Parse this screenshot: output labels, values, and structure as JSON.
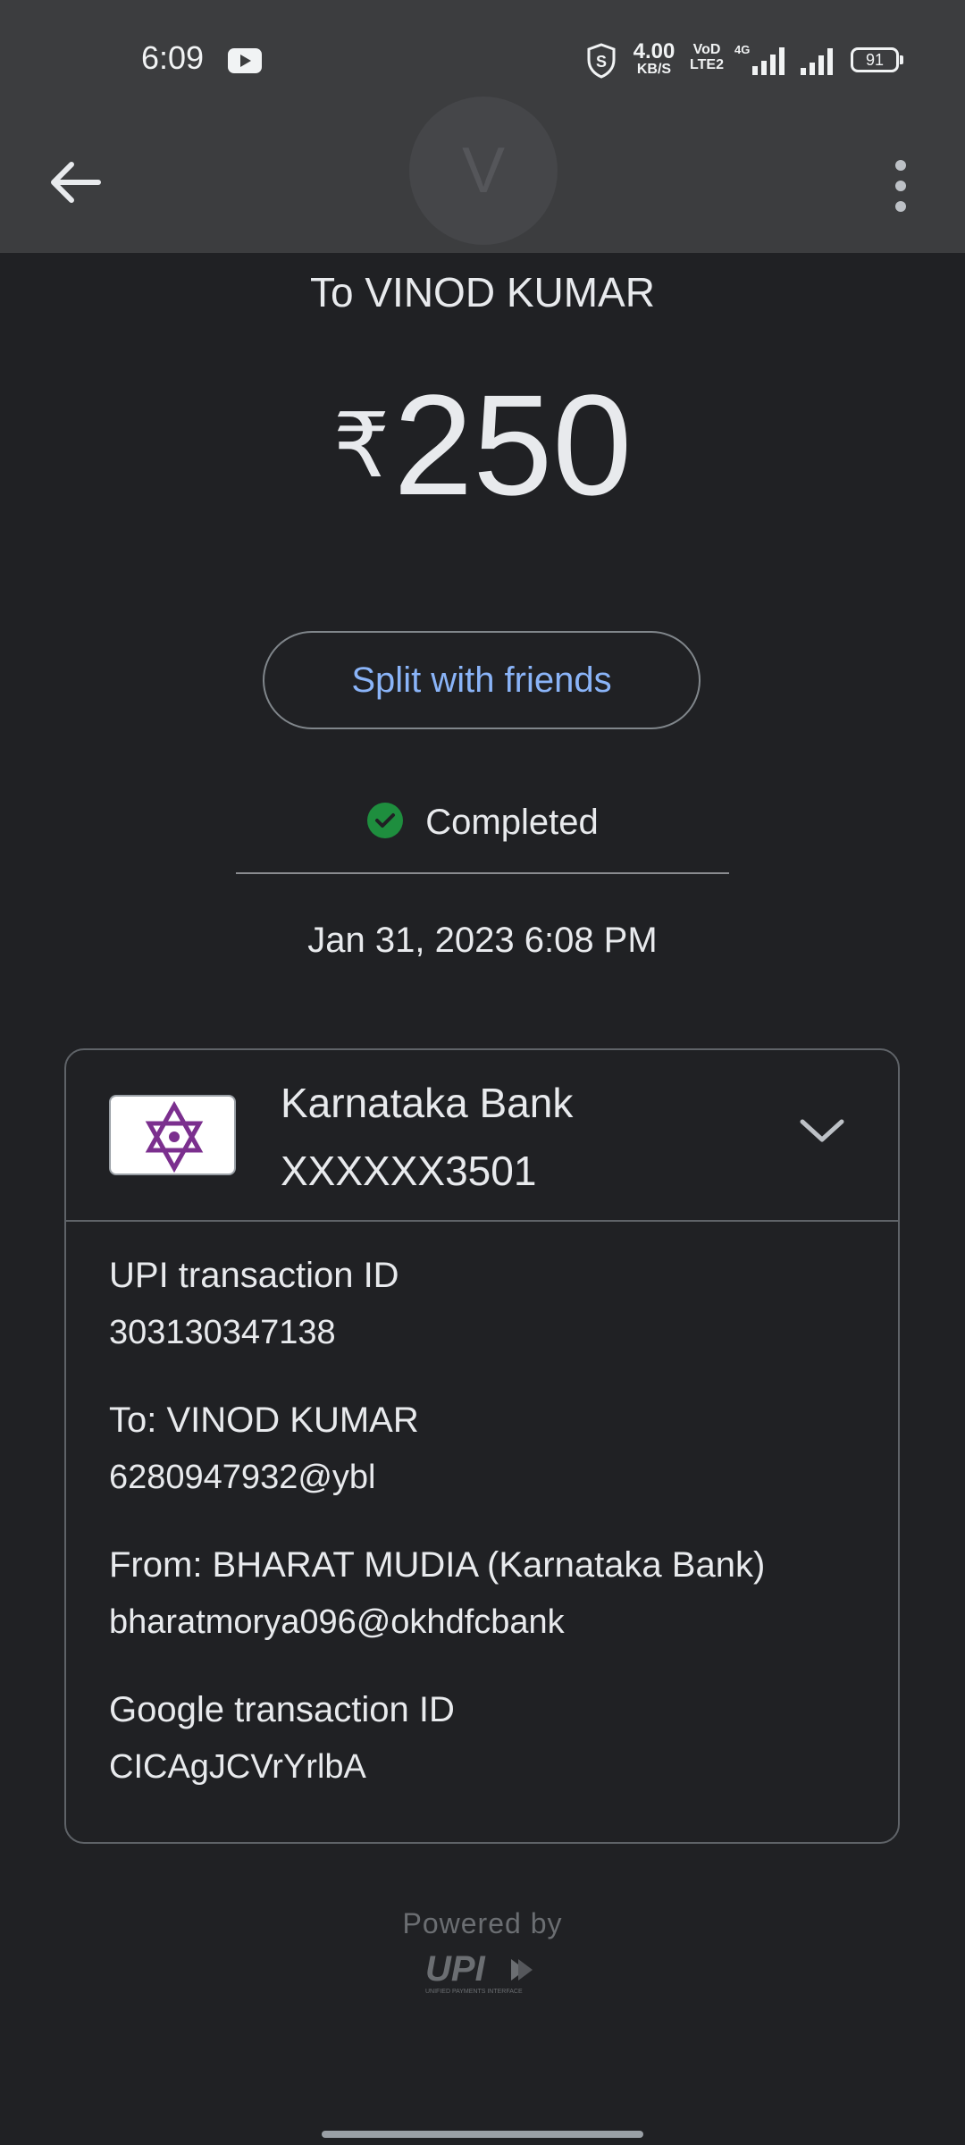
{
  "status_bar": {
    "time": "6:09",
    "net_speed_value": "4.00",
    "net_speed_unit": "KB/S",
    "volte_line1": "VoD",
    "volte_line2": "LTE2",
    "signal_label": "4G",
    "battery": "91"
  },
  "app_bar": {
    "avatar_initial": "V"
  },
  "payment": {
    "to_line": "To VINOD KUMAR",
    "currency_symbol": "₹",
    "amount": "250",
    "split_label": "Split with friends",
    "status": "Completed",
    "datetime": "Jan 31, 2023 6:08 PM"
  },
  "bank": {
    "name": "Karnataka Bank",
    "account": "XXXXXX3501"
  },
  "details": [
    {
      "label": "UPI transaction ID",
      "value": "303130347138"
    },
    {
      "label": "To: VINOD KUMAR",
      "value": "6280947932@ybl"
    },
    {
      "label": "From: BHARAT MUDIA (Karnataka Bank)",
      "value": "bharatmorya096@okhdfcbank"
    },
    {
      "label": "Google transaction ID",
      "value": "CICAgJCVrYrlbA"
    }
  ],
  "footer": {
    "powered_by": "Powered by",
    "upi_logo_text": "UPI",
    "upi_tagline": "UNIFIED PAYMENTS INTERFACE"
  },
  "colors": {
    "background": "#202124",
    "header": "#3c3d3f",
    "link": "#8ab4f8",
    "success": "#1e8e3e",
    "bank_logo": "#7b2f8e"
  }
}
